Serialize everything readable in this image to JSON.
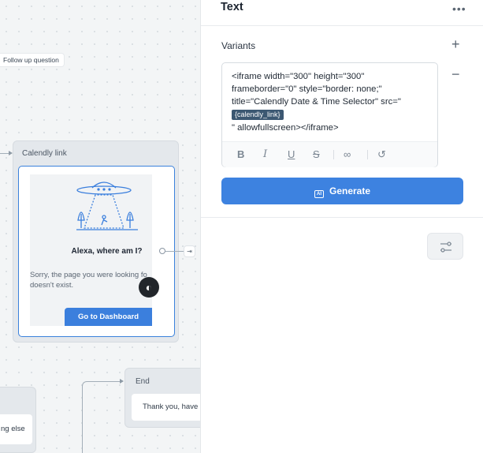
{
  "canvas": {
    "chip_label": "Follow up question",
    "calendly_block": {
      "title": "Calendly link",
      "preview_heading": "Alexa, where am I?",
      "preview_body_line1": "Sorry, the page you were looking fo",
      "preview_body_line2": "doesn't exist.",
      "dashboard_button": "Go to Dashboard"
    },
    "end_block": {
      "title": "End",
      "message": "Thank you, have"
    },
    "left_block": {
      "message": "ng else"
    }
  },
  "panel": {
    "title": "Text",
    "more_icon": "more-horizontal-icon",
    "variants_label": "Variants",
    "editor": {
      "line1": "<iframe width=\"300\" height=\"300\"",
      "line2": "frameborder=\"0\" style=\"border: none;\"",
      "line3": "title=\"Calendly Date & Time Selector\" src=\"",
      "variable": "{calendly_link}",
      "line4": "\" allowfullscreen></iframe>"
    },
    "toolbar": [
      "bold-icon",
      "italic-icon",
      "underline-icon",
      "strikethrough-icon",
      "link-icon",
      "history-icon"
    ],
    "generate_label": "Generate"
  },
  "colors": {
    "accent": "#3d82e0",
    "variable_chip": "#3c5872"
  }
}
